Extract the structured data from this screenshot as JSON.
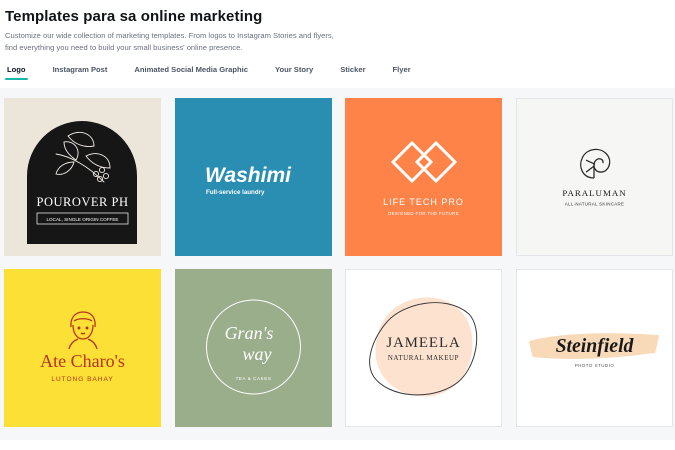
{
  "header": {
    "title": "Templates para sa online marketing",
    "description": "Customize our wide collection of marketing templates. From logos to Instagram Stories and flyers, find everything you need to build your small business' online presence."
  },
  "tabs": [
    {
      "label": "Logo",
      "active": true
    },
    {
      "label": "Instagram Post",
      "active": false
    },
    {
      "label": "Animated Social Media Graphic",
      "active": false
    },
    {
      "label": "Your Story",
      "active": false
    },
    {
      "label": "Sticker",
      "active": false
    },
    {
      "label": "Flyer",
      "active": false
    }
  ],
  "colors": {
    "accent_tab": "#14b8a6",
    "pourover_bg": "#ece6da",
    "washimi_bg": "#2a8db2",
    "lifetech_bg": "#fe8348",
    "paraluman_bg": "#f6f6f4",
    "atecharos_bg": "#fde036",
    "gransway_bg": "#9aae8c",
    "jameela_bg": "#ffffff",
    "steinfield_bg": "#ffffff"
  },
  "templates": [
    {
      "name": "POUROVER PH",
      "tagline": "LOCAL, SINGLE ORIGIN COFFEE",
      "icon": "coffee-branch-icon"
    },
    {
      "name": "Washimi",
      "tagline": "Full-service laundry"
    },
    {
      "name": "LIFE TECH PRO",
      "tagline": "DESIGNED FOR THE FUTURE",
      "icon": "interlocked-diamonds-icon"
    },
    {
      "name": "PARALUMAN",
      "tagline": "ALL-NATURAL SKINCARE",
      "icon": "nautilus-shell-icon"
    },
    {
      "name": "Ate Charo's",
      "tagline": "LUTONG BAHAY",
      "icon": "woman-portrait-icon"
    },
    {
      "name_line1": "Gran's",
      "name_line2": "way",
      "tagline": "TEA & CAKES"
    },
    {
      "name": "JAMEELA",
      "tagline": "NATURAL MAKEUP"
    },
    {
      "name": "Steinfield",
      "tagline": "PHOTO STUDIO"
    }
  ]
}
